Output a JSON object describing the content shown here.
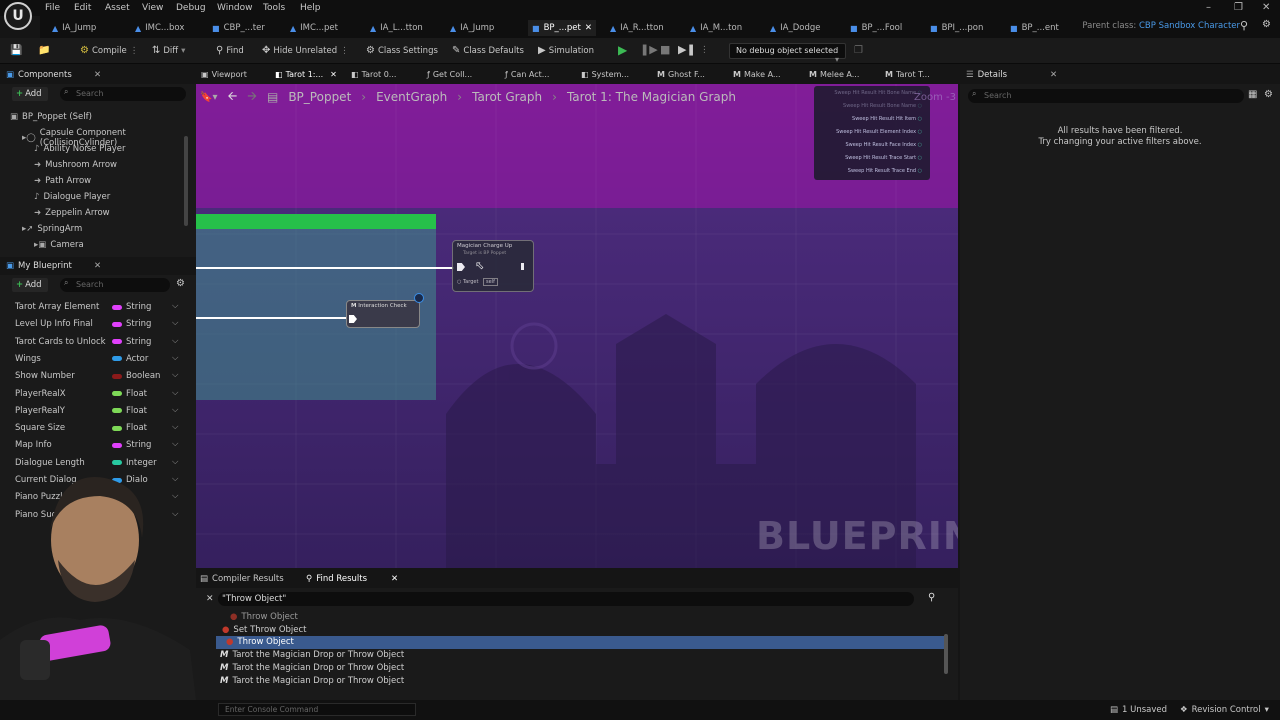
{
  "menubar": {
    "items": [
      "File",
      "Edit",
      "Asset",
      "View",
      "Debug",
      "Window",
      "Tools",
      "Help"
    ]
  },
  "tabs": [
    {
      "label": "IA_Jump"
    },
    {
      "label": "IMC...box"
    },
    {
      "label": "CBP_...ter"
    },
    {
      "label": "IMC...pet"
    },
    {
      "label": "IA_L...tton"
    },
    {
      "label": "IA_Jump"
    },
    {
      "label": "BP_...pet"
    },
    {
      "label": "IA_R...tton"
    },
    {
      "label": "IA_M...ton"
    },
    {
      "label": "IA_Dodge"
    },
    {
      "label": "BP_...Fool"
    },
    {
      "label": "BPI_...pon"
    },
    {
      "label": "BP_...ent"
    }
  ],
  "parent_class": {
    "label": "Parent class:",
    "value": "CBP Sandbox Character"
  },
  "toolbar": {
    "compile": "Compile",
    "diff": "Diff",
    "find": "Find",
    "hide_unrelated": "Hide Unrelated",
    "class_settings": "Class Settings",
    "class_defaults": "Class Defaults",
    "simulation": "Simulation",
    "debug_selector": "No debug object selected"
  },
  "components": {
    "title": "Components",
    "add": "Add",
    "search_placeholder": "Search",
    "items": [
      {
        "label": "BP_Poppet (Self)"
      },
      {
        "label": "Capsule Component (CollisionCylinder)"
      },
      {
        "label": "Ability Noise Player"
      },
      {
        "label": "Mushroom Arrow"
      },
      {
        "label": "Path Arrow"
      },
      {
        "label": "Dialogue Player"
      },
      {
        "label": "Zeppelin Arrow"
      },
      {
        "label": "SpringArm"
      },
      {
        "label": "Camera"
      }
    ]
  },
  "my_blueprint": {
    "title": "My Blueprint",
    "add": "Add",
    "search_placeholder": "Search",
    "variables": [
      {
        "name": "Tarot Array Element",
        "type": "String",
        "color": "#e040fb"
      },
      {
        "name": "Level Up Info Final",
        "type": "String",
        "color": "#e040fb"
      },
      {
        "name": "Tarot Cards to Unlock",
        "type": "String",
        "color": "#e040fb"
      },
      {
        "name": "Wings",
        "type": "Actor",
        "color": "#2f9be8"
      },
      {
        "name": "Show Number",
        "type": "Boolean",
        "color": "#8b1a1a"
      },
      {
        "name": "PlayerRealX",
        "type": "Float",
        "color": "#7ed957"
      },
      {
        "name": "PlayerRealY",
        "type": "Float",
        "color": "#7ed957"
      },
      {
        "name": "Square Size",
        "type": "Float",
        "color": "#7ed957"
      },
      {
        "name": "Map Info",
        "type": "String",
        "color": "#e040fb"
      },
      {
        "name": "Dialogue Length",
        "type": "Integer",
        "color": "#28c8a0"
      },
      {
        "name": "Current Dialog",
        "type": "Dialo",
        "color": "#2f9be8"
      },
      {
        "name": "Piano Puzzle",
        "type": "",
        "color": "#777"
      },
      {
        "name": "Piano Succes",
        "type": "",
        "color": "#777"
      }
    ]
  },
  "graph_tabs": [
    {
      "label": "Viewport"
    },
    {
      "label": "Tarot 1:..."
    },
    {
      "label": "Tarot 0..."
    },
    {
      "label": "Get Coll..."
    },
    {
      "label": "Can Act..."
    },
    {
      "label": "System..."
    },
    {
      "label": "Ghost F..."
    },
    {
      "label": "Make A..."
    },
    {
      "label": "Melee A..."
    },
    {
      "label": "Tarot T..."
    }
  ],
  "breadcrumb": [
    "BP_Poppet",
    "EventGraph",
    "Tarot Graph",
    "Tarot 1: The Magician Graph"
  ],
  "graph": {
    "watermark": "BLUEPRINT",
    "zoom": "Zoom -3",
    "node_magician": {
      "title": "Magician Charge Up",
      "subtitle": "Target is BP Poppet",
      "target": "Target",
      "self": "self"
    },
    "node_interaction": {
      "title": "Interaction Check"
    },
    "break_hit": [
      "Sweep Hit Result Hit Bone Name",
      "Sweep Hit Result Bone Name",
      "Sweep Hit Result Hit Item",
      "Sweep Hit Result Element Index",
      "Sweep Hit Result Face Index",
      "Sweep Hit Result Trace Start",
      "Sweep Hit Result Trace End"
    ]
  },
  "details": {
    "title": "Details",
    "search_placeholder": "Search",
    "message1": "All results have been filtered.",
    "message2": "Try changing your active filters above."
  },
  "bottom": {
    "compiler_tab": "Compiler Results",
    "find_tab": "Find Results",
    "query": "\"Throw Object\"",
    "results": [
      {
        "label": "Throw Object",
        "kind": "node"
      },
      {
        "label": "Set Throw Object",
        "kind": "node"
      },
      {
        "label": "Throw Object",
        "kind": "var",
        "selected": true
      },
      {
        "label": "Tarot the Magician Drop or Throw Object",
        "kind": "func"
      },
      {
        "label": "Tarot the Magician Drop or Throw Object",
        "kind": "func"
      },
      {
        "label": "Tarot the Magician Drop or Throw Object",
        "kind": "func"
      }
    ]
  },
  "statusbar": {
    "console_placeholder": "Enter Console Command",
    "unsaved": "1 Unsaved",
    "revision": "Revision Control"
  }
}
